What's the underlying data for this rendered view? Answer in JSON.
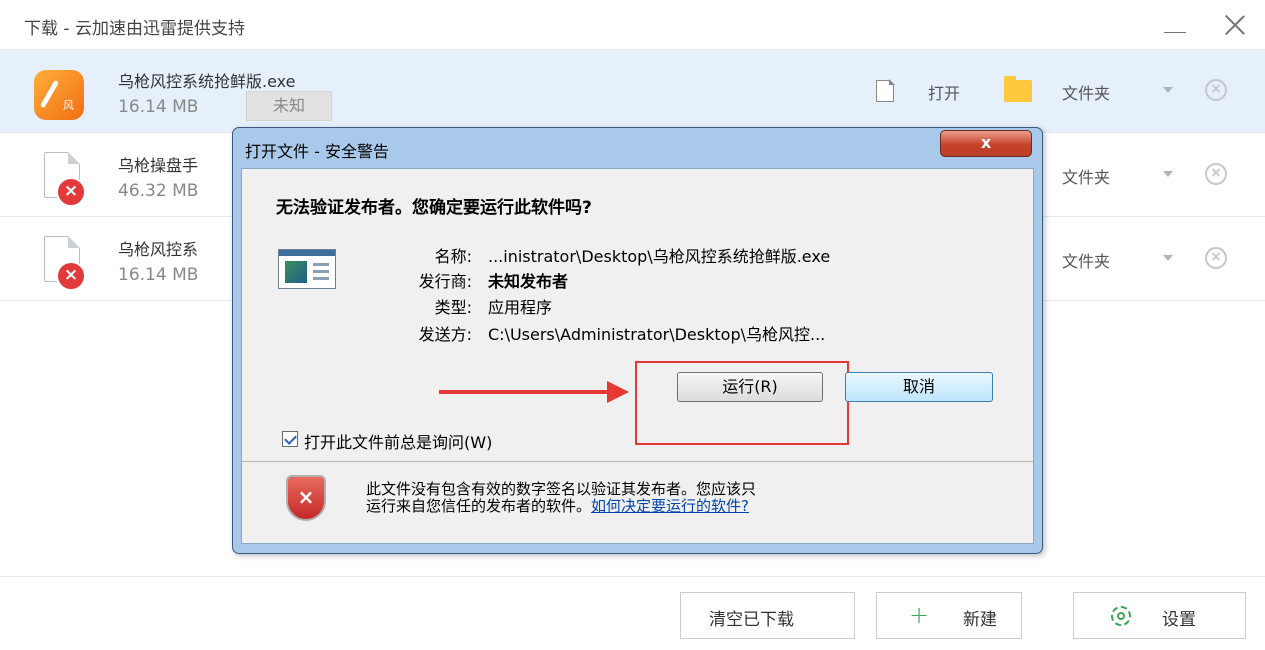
{
  "window": {
    "title": "下载 - 云加速由迅雷提供支持"
  },
  "downloads": [
    {
      "name": "乌枪风控系统抢鲜版.exe",
      "size": "16.14 MB",
      "status_badge": "未知",
      "actions": {
        "open": "打开",
        "folder": "文件夹"
      }
    },
    {
      "name": "乌枪操盘手",
      "size": "46.32 MB",
      "actions": {
        "folder": "文件夹"
      }
    },
    {
      "name": "乌枪风控系",
      "size": "16.14 MB",
      "actions": {
        "folder": "文件夹"
      }
    }
  ],
  "footer": {
    "clear_label": "清空已下载",
    "new_label": "新建",
    "settings_label": "设置"
  },
  "dialog": {
    "title": "打开文件 - 安全警告",
    "close_glyph": "x",
    "question": "无法验证发布者。您确定要运行此软件吗?",
    "fields": [
      {
        "label": "名称:",
        "value": "...inistrator\\Desktop\\乌枪风控系统抢鲜版.exe"
      },
      {
        "label": "发行商:",
        "value": "未知发布者"
      },
      {
        "label": "类型:",
        "value": "应用程序"
      },
      {
        "label": "发送方:",
        "value": "C:\\Users\\Administrator\\Desktop\\乌枪风控..."
      }
    ],
    "run_label": "运行(R)",
    "cancel_label": "取消",
    "checkbox_label": "打开此文件前总是询问(W)",
    "checkbox_checked": true,
    "warning_line1": "此文件没有包含有效的数字签名以验证其发布者。您应该只",
    "warning_line2": "运行来自您信任的发布者的软件。",
    "warning_link": "如何决定要运行的软件?"
  },
  "colors": {
    "selected_row": "#e6f0fb",
    "dialog_frame": "#a9c9ea",
    "highlight": "#e53935",
    "accent_green": "#3aa757"
  },
  "icons": [
    "app-icon",
    "file-error-icon",
    "document-icon",
    "folder-icon",
    "caret-down-icon",
    "cancel-circle-icon",
    "plus-icon",
    "gear-icon",
    "shield-error-icon",
    "close-icon",
    "minimize-icon"
  ]
}
